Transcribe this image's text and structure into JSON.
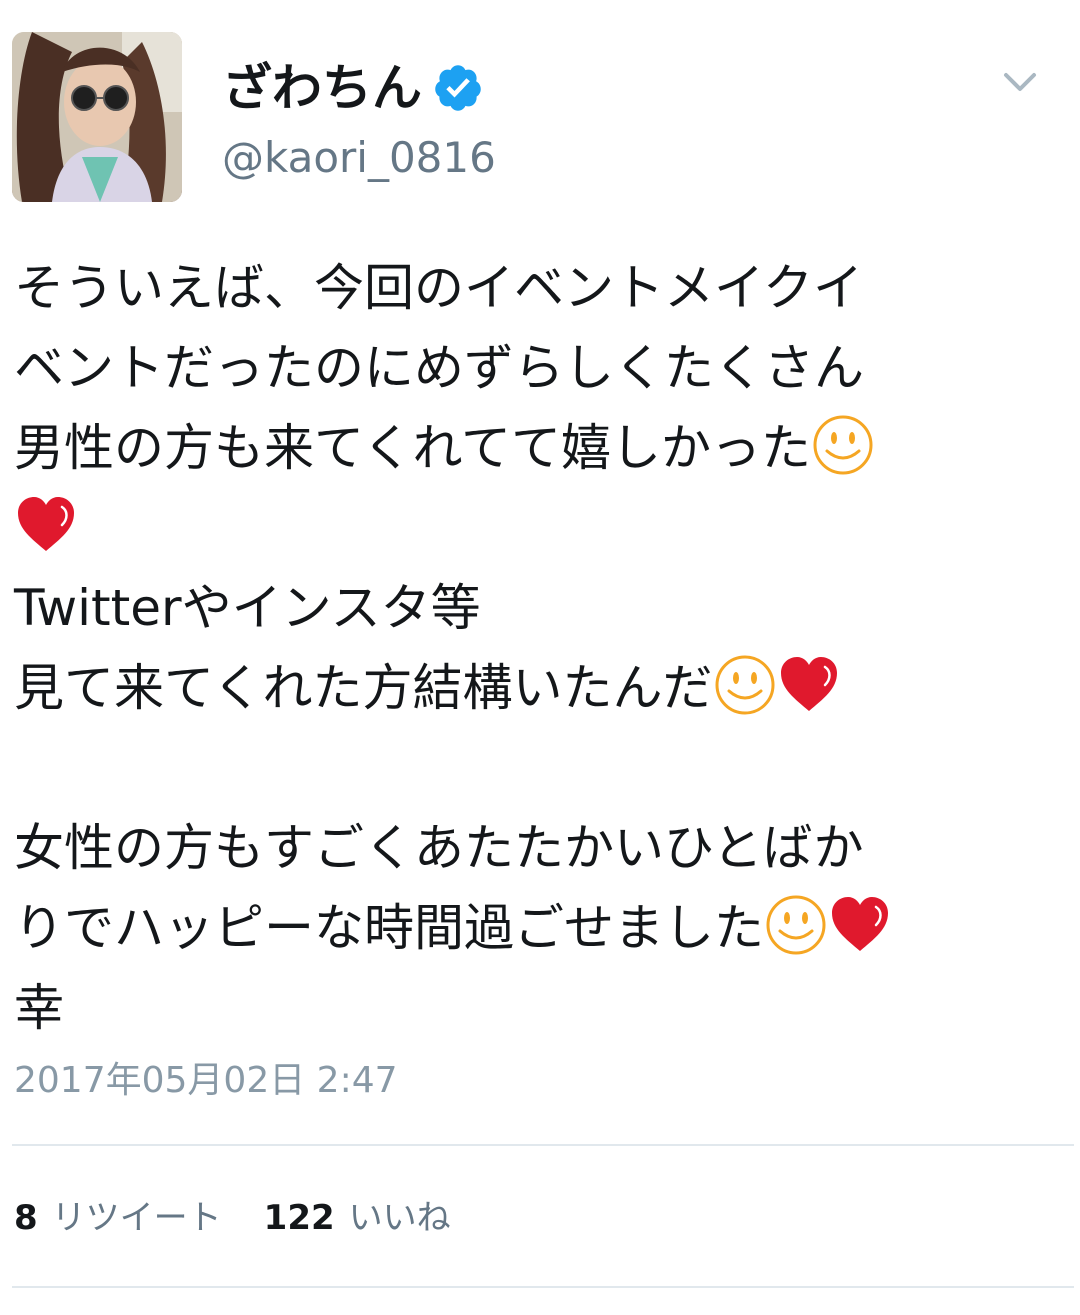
{
  "user": {
    "display_name": "ざわちん",
    "handle": "@kaori_0816",
    "verified_icon": "verified-badge-icon",
    "verified_color": "#1da1f2"
  },
  "tweet": {
    "lines": [
      "そういえば、今回のイベントメイクイ",
      "ベントだったのにめずらしくたくさん",
      "男性の方も来てくれてて嬉しかった",
      "",
      "Twitterやインスタ等",
      "見て来てくれた方結構いたんだ",
      "",
      "女性の方もすごくあたたかいひとばか",
      "りでハッピーな時間過ごせました",
      "幸"
    ],
    "emoji_names": [
      "smiley-face-icon",
      "red-heart-icon"
    ],
    "emoji_colors": {
      "smiley": "#f5a623",
      "heart": "#e0192d"
    },
    "timestamp": "2017年05月02日 2:47"
  },
  "stats": {
    "retweets_count": "8",
    "retweets_label": "リツイート",
    "likes_count": "122",
    "likes_label": "いいね"
  }
}
